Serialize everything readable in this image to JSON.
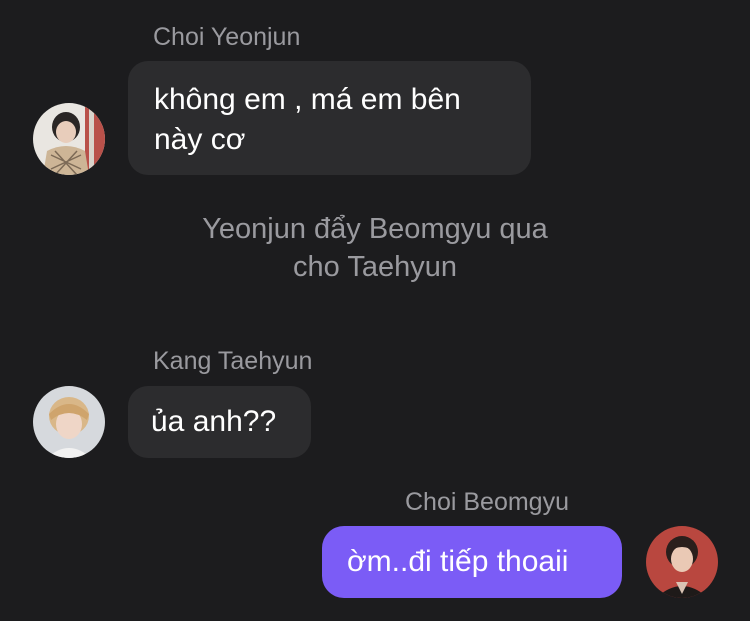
{
  "messages": [
    {
      "sender": "Choi Yeonjun",
      "lines": [
        "không em , má em bên",
        "này cơ"
      ],
      "avatar_icon": "yeonjun-avatar"
    },
    {
      "sender": "Kang Taehyun",
      "lines": [
        "ủa anh??"
      ],
      "avatar_icon": "taehyun-avatar"
    },
    {
      "sender": "Choi Beomgyu",
      "lines": [
        "ờm..đi tiếp thoaii"
      ],
      "avatar_icon": "beomgyu-avatar"
    }
  ],
  "system_message": {
    "lines": [
      "Yeonjun đẩy Beomgyu qua",
      "cho Taehyun"
    ]
  },
  "colors": {
    "background": "#1c1c1e",
    "incoming_bubble": "#2c2c2e",
    "outgoing_bubble": "#7b5cf6",
    "secondary_text": "#9a9a9f"
  }
}
